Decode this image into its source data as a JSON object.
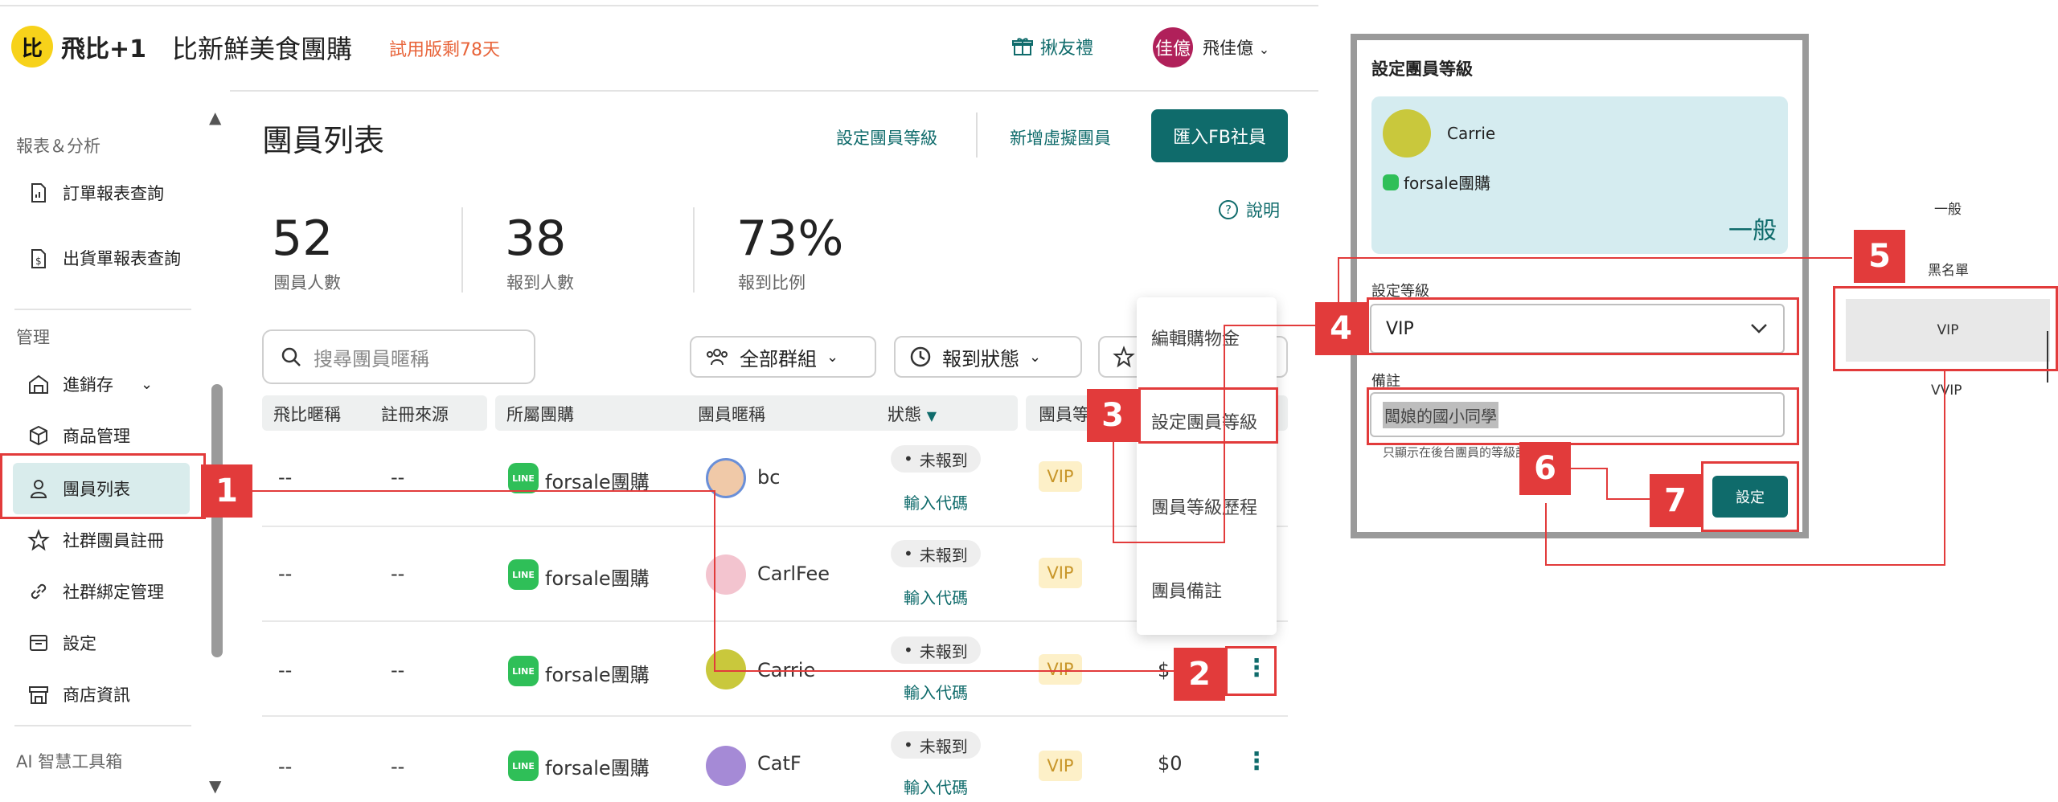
{
  "header": {
    "brand_badge": "比",
    "brand_name": "飛比+1",
    "store_name": "比新鮮美食團購",
    "trial_text": "試用版剩78天",
    "invite_label": "揪友禮",
    "avatar_initials": "佳億",
    "user_name": "飛佳億"
  },
  "sidebar": {
    "section_reports": "報表＆分析",
    "report_items": [
      {
        "label": "訂單報表查詢",
        "icon": "file-chart-icon"
      },
      {
        "label": "出貨單報表查詢",
        "label_line2": "詢",
        "icon": "file-dollar-icon"
      }
    ],
    "section_manage": "管理",
    "manage_items": [
      {
        "label": "進銷存",
        "icon": "warehouse-icon"
      },
      {
        "label": "商品管理",
        "icon": "box-icon"
      },
      {
        "label": "團員列表",
        "icon": "user-icon"
      },
      {
        "label": "社群團員註冊",
        "icon": "star-icon"
      },
      {
        "label": "社群綁定管理",
        "icon": "link-icon"
      },
      {
        "label": "設定",
        "icon": "settings-icon"
      },
      {
        "label": "商店資訊",
        "icon": "store-icon"
      }
    ],
    "section_ai": "AI 智慧工具箱"
  },
  "main": {
    "title": "團員列表",
    "actions": {
      "set_level": "設定團員等級",
      "add_virtual": "新增虛擬團員",
      "import_fb": "匯入FB社員"
    },
    "help": "說明",
    "stats": [
      {
        "value": "52",
        "label": "團員人數"
      },
      {
        "value": "38",
        "label": "報到人數"
      },
      {
        "value": "73%",
        "label": "報到比例"
      }
    ],
    "search_placeholder": "搜尋團員暱稱",
    "filters": {
      "group": "全部群組",
      "checkin": "報到狀態"
    },
    "columns": [
      "飛比暱稱",
      "註冊來源",
      "所屬團購",
      "團員暱稱",
      "狀態",
      "團員等"
    ],
    "rows": [
      {
        "fb_nick": "--",
        "source": "--",
        "group": "forsale團購",
        "member": "bc",
        "status": "未報到",
        "code": "輸入代碼",
        "level": "VIP",
        "amount": ""
      },
      {
        "fb_nick": "--",
        "source": "--",
        "group": "forsale團購",
        "member": "CarlFee",
        "status": "未報到",
        "code": "輸入代碼",
        "level": "VIP",
        "amount": ""
      },
      {
        "fb_nick": "--",
        "source": "--",
        "group": "forsale團購",
        "member": "Carrie",
        "status": "未報到",
        "code": "輸入代碼",
        "level": "VIP",
        "amount": "$"
      },
      {
        "fb_nick": "--",
        "source": "--",
        "group": "forsale團購",
        "member": "CatF",
        "status": "未報到",
        "code": "輸入代碼",
        "level": "VIP",
        "amount": "$0"
      }
    ],
    "line_badge": "LINE",
    "menu_items": [
      "編輯購物金",
      "設定團員等級",
      "團員等級歷程",
      "團員備註"
    ]
  },
  "dialog": {
    "title": "設定團員等級",
    "member_name": "Carrie",
    "group_name": "forsale團購",
    "current_level": "一般",
    "level_label": "設定等級",
    "level_value": "VIP",
    "note_label": "備註",
    "note_value": "闆娘的國小同學",
    "hint": "只顯示在後台團員的等級記",
    "submit": "設定"
  },
  "level_options": [
    "一般",
    "黑名單",
    "VIP",
    "VVIP"
  ],
  "annotations": [
    "1",
    "2",
    "3",
    "4",
    "5",
    "6",
    "7"
  ],
  "colors": {
    "primary": "#0f6b6b",
    "annotation_red": "#e23b3b",
    "brand_yellow": "#f7d21a",
    "vip_bg": "#fdf0c8",
    "card_bg": "#d5ecf0"
  }
}
